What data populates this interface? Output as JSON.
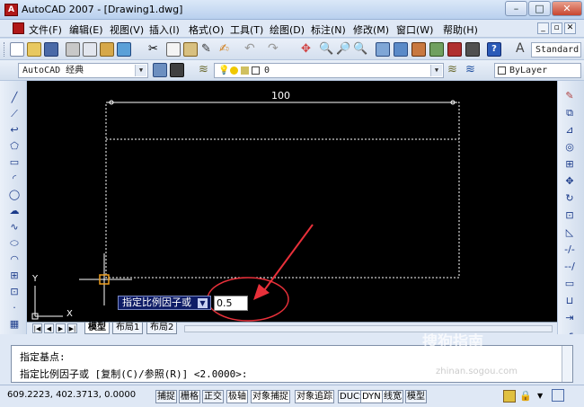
{
  "window": {
    "title": "AutoCAD 2007 - [Drawing1.dwg]",
    "min_label": "–",
    "max_label": "□",
    "close_label": "✕"
  },
  "menu": {
    "items": [
      "文件(F)",
      "编辑(E)",
      "视图(V)",
      "插入(I)",
      "格式(O)",
      "工具(T)",
      "绘图(D)",
      "标注(N)",
      "修改(M)",
      "窗口(W)",
      "帮助(H)"
    ]
  },
  "toolbar2": {
    "workspace": "AutoCAD 经典",
    "layer": "0",
    "color": "ByLayer"
  },
  "toolbar1": {
    "text_style": "Standard"
  },
  "canvas": {
    "dimension_text": "100",
    "ucs_x": "X",
    "ucs_y": "Y"
  },
  "dynamic_input": {
    "prompt": "指定比例因子或",
    "value": "0.5"
  },
  "layout_tabs": [
    "模型",
    "布局1",
    "布局2"
  ],
  "command": {
    "line1": "指定基点:",
    "line2": "指定比例因子或 [复制(C)/参照(R)] <2.0000>:"
  },
  "status": {
    "coords": "609.2223, 402.3713, 0.0000",
    "buttons": [
      "捕捉",
      "栅格",
      "正交",
      "极轴",
      "对象捕捉",
      "对象追踪",
      "DUCS",
      "DYN",
      "线宽",
      "模型"
    ],
    "on_state": [
      false,
      false,
      false,
      true,
      true,
      true,
      false,
      true,
      false,
      false
    ]
  },
  "watermark": {
    "text": "搜狗指南",
    "subtext": "zhinan.sogou.com"
  },
  "colors": {
    "canvas_bg": "#000000",
    "annotation_red": "#e8303a",
    "prompt_bg": "#0e1c66"
  },
  "icons": {
    "left_toolbar": [
      "line-icon",
      "construction-line-icon",
      "polyline-icon",
      "polygon-icon",
      "rectangle-icon",
      "arc-icon",
      "circle-icon",
      "revision-cloud-icon",
      "spline-icon",
      "ellipse-icon",
      "ellipse-arc-icon",
      "insert-block-icon",
      "make-block-icon",
      "point-icon",
      "hatch-icon"
    ],
    "right_toolbar": [
      "erase-icon",
      "copy-icon",
      "mirror-icon",
      "offset-icon",
      "array-icon",
      "move-icon",
      "rotate-icon",
      "scale-icon",
      "stretch-icon",
      "trim-icon",
      "extend-icon",
      "break-icon",
      "join-icon",
      "chamfer-icon",
      "fillet-icon"
    ]
  }
}
